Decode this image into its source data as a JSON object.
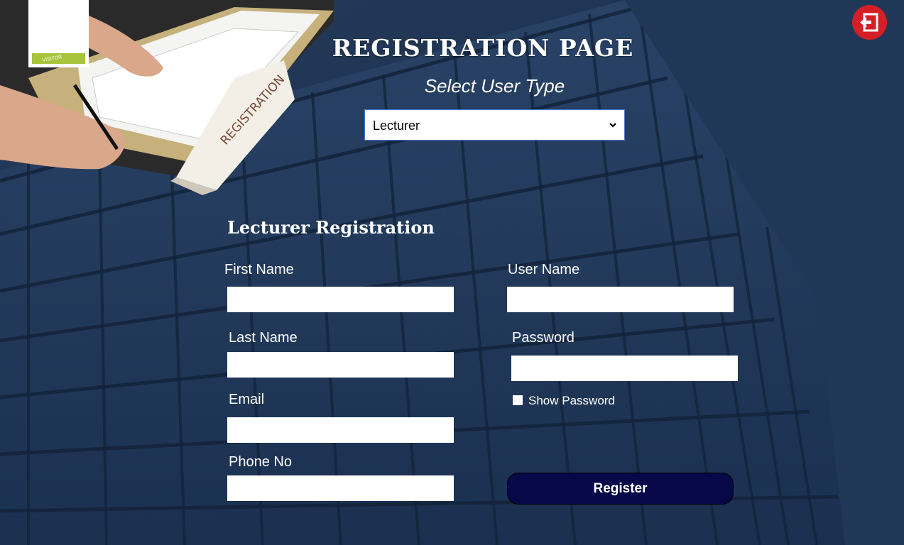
{
  "header": {
    "title": "REGISTRATION PAGE",
    "subtitle": "Select User Type"
  },
  "user_type_select": {
    "value": "Lecturer"
  },
  "form": {
    "title": "Lecturer Registration",
    "first_name_label": "First Name",
    "last_name_label": "Last Name",
    "email_label": "Email",
    "phone_label": "Phone No",
    "user_name_label": "User Name",
    "password_label": "Password",
    "show_password_label": "Show Password",
    "register_label": "Register"
  },
  "photo": {
    "sign_text": "REGISTRATION",
    "badge_text": "VISITOR"
  },
  "icons": {
    "exit": "exit-icon",
    "dropdown": "chevron-down-icon"
  },
  "colors": {
    "background": "#1f3350",
    "register_button": "#060848",
    "exit_button": "#d51f26",
    "select_border": "#4a7bd0"
  }
}
